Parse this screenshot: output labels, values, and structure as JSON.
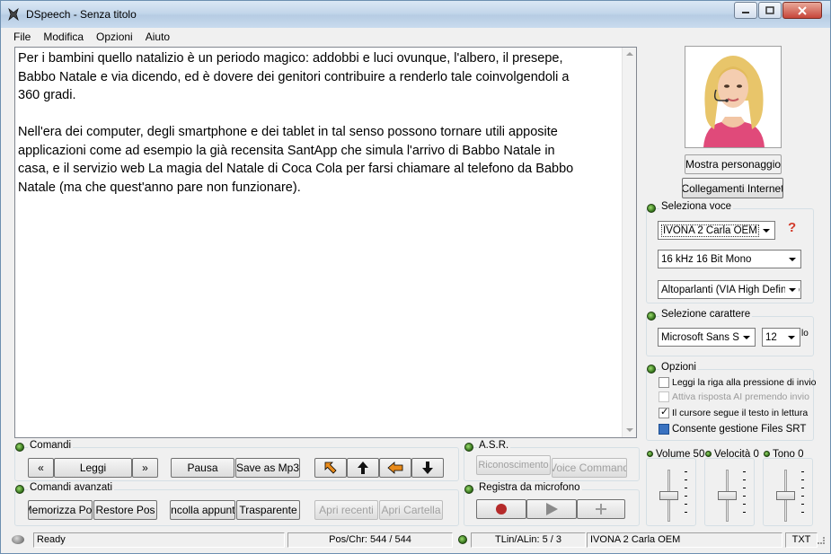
{
  "window": {
    "title": "DSpeech - Senza titolo"
  },
  "menu": {
    "items": [
      "File",
      "Modifica",
      "Opzioni",
      "Aiuto"
    ]
  },
  "editor": {
    "text": "Per i bambini quello natalizio è un periodo magico: addobbi e luci ovunque, l'albero, il presepe,\nBabbo Natale e via dicendo, ed è dovere dei genitori contribuire a renderlo tale coinvolgendoli a\n360 gradi.\n\nNell'era dei computer, degli smartphone e dei tablet in tal senso possono tornare utili apposite\napplicazioni come ad esempio la già recensita SantApp che simula l'arrivo di Babbo Natale in\ncasa, e il servizio web La magia del Natale di Coca Cola per farsi chiamare al telefono da Babbo\nNatale (ma che quest'anno pare non funzionare)."
  },
  "side": {
    "show_character": "Mostra personaggio",
    "internet_links": "Collegamenti Internet",
    "voice_group": "Seleziona voce",
    "voice": "IVONA 2 Carla OEM",
    "help": "?",
    "format": "16 kHz 16 Bit Mono",
    "output": "Altoparlanti (VIA High Definitio",
    "font_group": "Selezione carattere",
    "font": "Microsoft Sans Se",
    "font_size": "12",
    "font_size_suffix": "lo",
    "options_group": "Opzioni",
    "options": [
      {
        "label": "Leggi la riga alla pressione di invio",
        "checked": false,
        "enabled": true
      },
      {
        "label": "Attiva risposta AI premendo invio",
        "checked": false,
        "enabled": false
      },
      {
        "label": "Il cursore segue il testo in lettura",
        "checked": true,
        "enabled": true
      },
      {
        "label": "Consente gestione Files SRT",
        "checked": true,
        "enabled": true
      }
    ]
  },
  "commands": {
    "group": "Comandi",
    "prev": "«",
    "read": "Leggi",
    "next": "»",
    "pause": "Pausa",
    "save_mp3": "Save as Mp3"
  },
  "advanced": {
    "group": "Comandi avanzati",
    "save_pos": "Memorizza Pos",
    "restore_pos": "Restore Pos",
    "paste": "Incolla appunti",
    "transparent": "Trasparente",
    "recent": "Apri recenti",
    "folder": "Apri Cartella"
  },
  "asr": {
    "group": "A.S.R.",
    "recognition": "Riconoscimento",
    "voice_command": "Voice Command"
  },
  "record": {
    "group": "Registra da microfono"
  },
  "sliders": {
    "volume_label": "Volume 50",
    "volume": 50,
    "speed_label": "Velocità 0",
    "speed": 0,
    "pitch_label": "Tono 0",
    "pitch": 0
  },
  "status": {
    "ready": "Ready",
    "pos": "Pos/Chr: 544 / 544",
    "lines": "TLin/ALin: 5 / 3",
    "voice": "IVONA 2 Carla OEM",
    "type": "TXT"
  },
  "colors": {
    "accent_green": "#2d6b16",
    "record_red": "#b52a2a",
    "arrow_orange": "#e88a1a"
  }
}
